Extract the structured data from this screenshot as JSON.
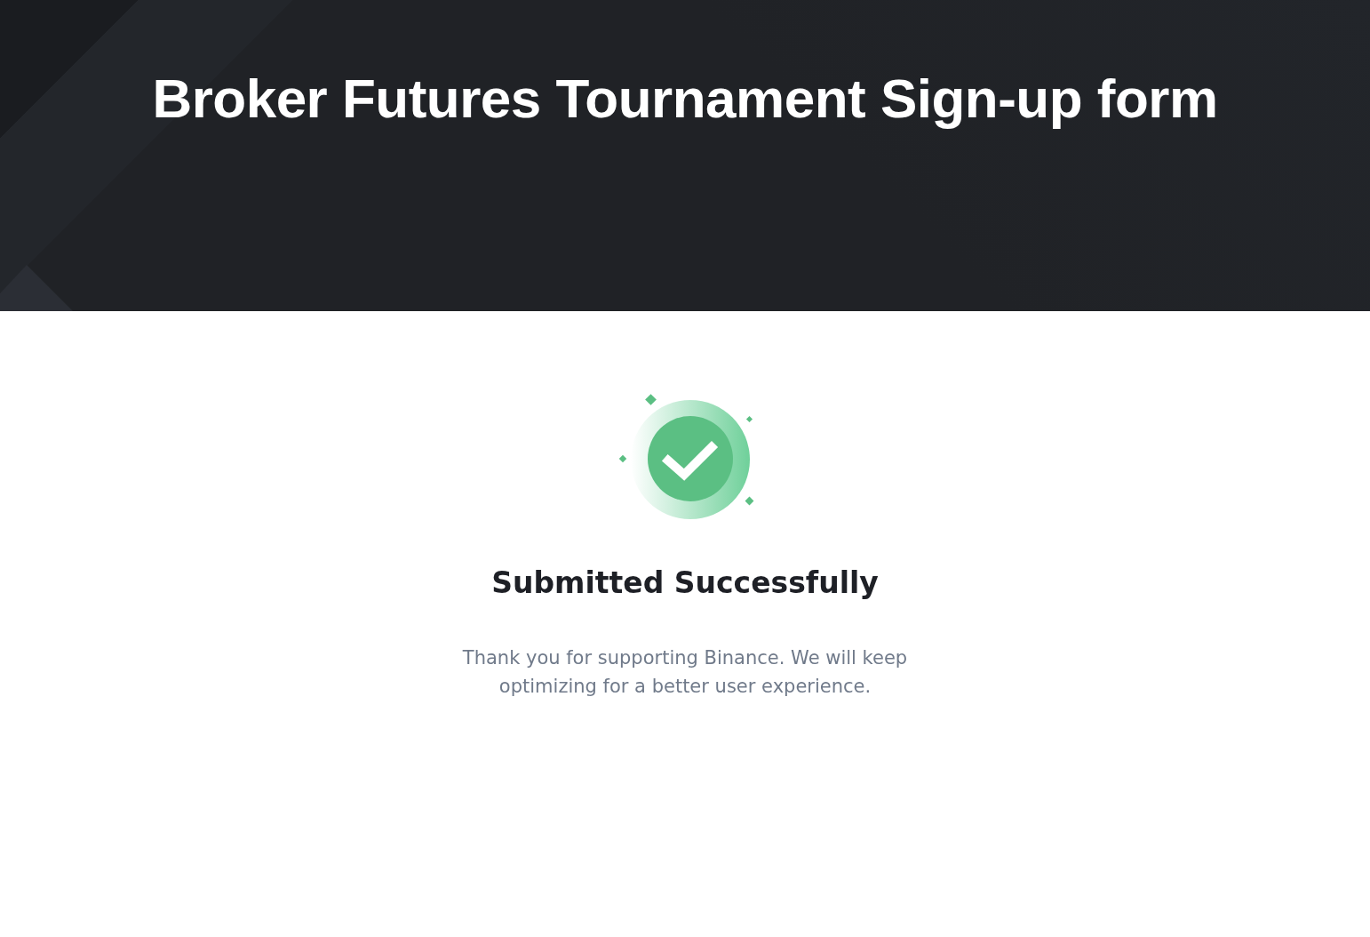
{
  "header": {
    "title": "Broker Futures Tournament Sign-up form"
  },
  "result": {
    "kind": "success",
    "heading": "Submitted Successfully",
    "message": "Thank you for supporting Binance. We will keep optimizing for a better user experience."
  }
}
